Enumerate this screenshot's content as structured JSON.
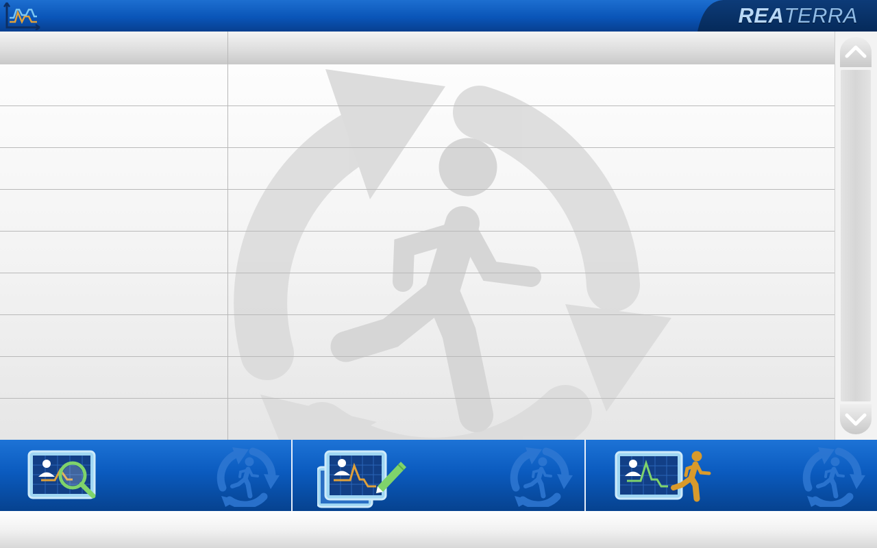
{
  "app": {
    "brand_bold": "REA",
    "brand_light": "TERRA",
    "icon": "trend-chart-icon"
  },
  "table": {
    "columns": [
      "",
      ""
    ],
    "rows": [
      [
        "",
        ""
      ],
      [
        "",
        ""
      ],
      [
        "",
        ""
      ],
      [
        "",
        ""
      ],
      [
        "",
        ""
      ],
      [
        "",
        ""
      ],
      [
        "",
        ""
      ],
      [
        "",
        ""
      ]
    ],
    "watermark_icon": "running-person-cycle-icon"
  },
  "scroll": {
    "up_icon": "chevron-up-icon",
    "down_icon": "chevron-down-icon"
  },
  "actions": [
    {
      "name": "review-exercise-button",
      "icon": "patient-graph-magnifier-icon",
      "badge": "running-person-cycle-icon"
    },
    {
      "name": "edit-exercise-button",
      "icon": "patient-graph-pencil-icon",
      "badge": "running-person-cycle-icon"
    },
    {
      "name": "start-exercise-button",
      "icon": "patient-graph-runner-icon",
      "badge": "running-person-cycle-icon"
    }
  ],
  "colors": {
    "primary_blue": "#0b5bbf",
    "dark_blue": "#06428f",
    "accent_green": "#7fd36b",
    "accent_orange": "#e0a13a",
    "accent_gold": "#d99a2b"
  }
}
